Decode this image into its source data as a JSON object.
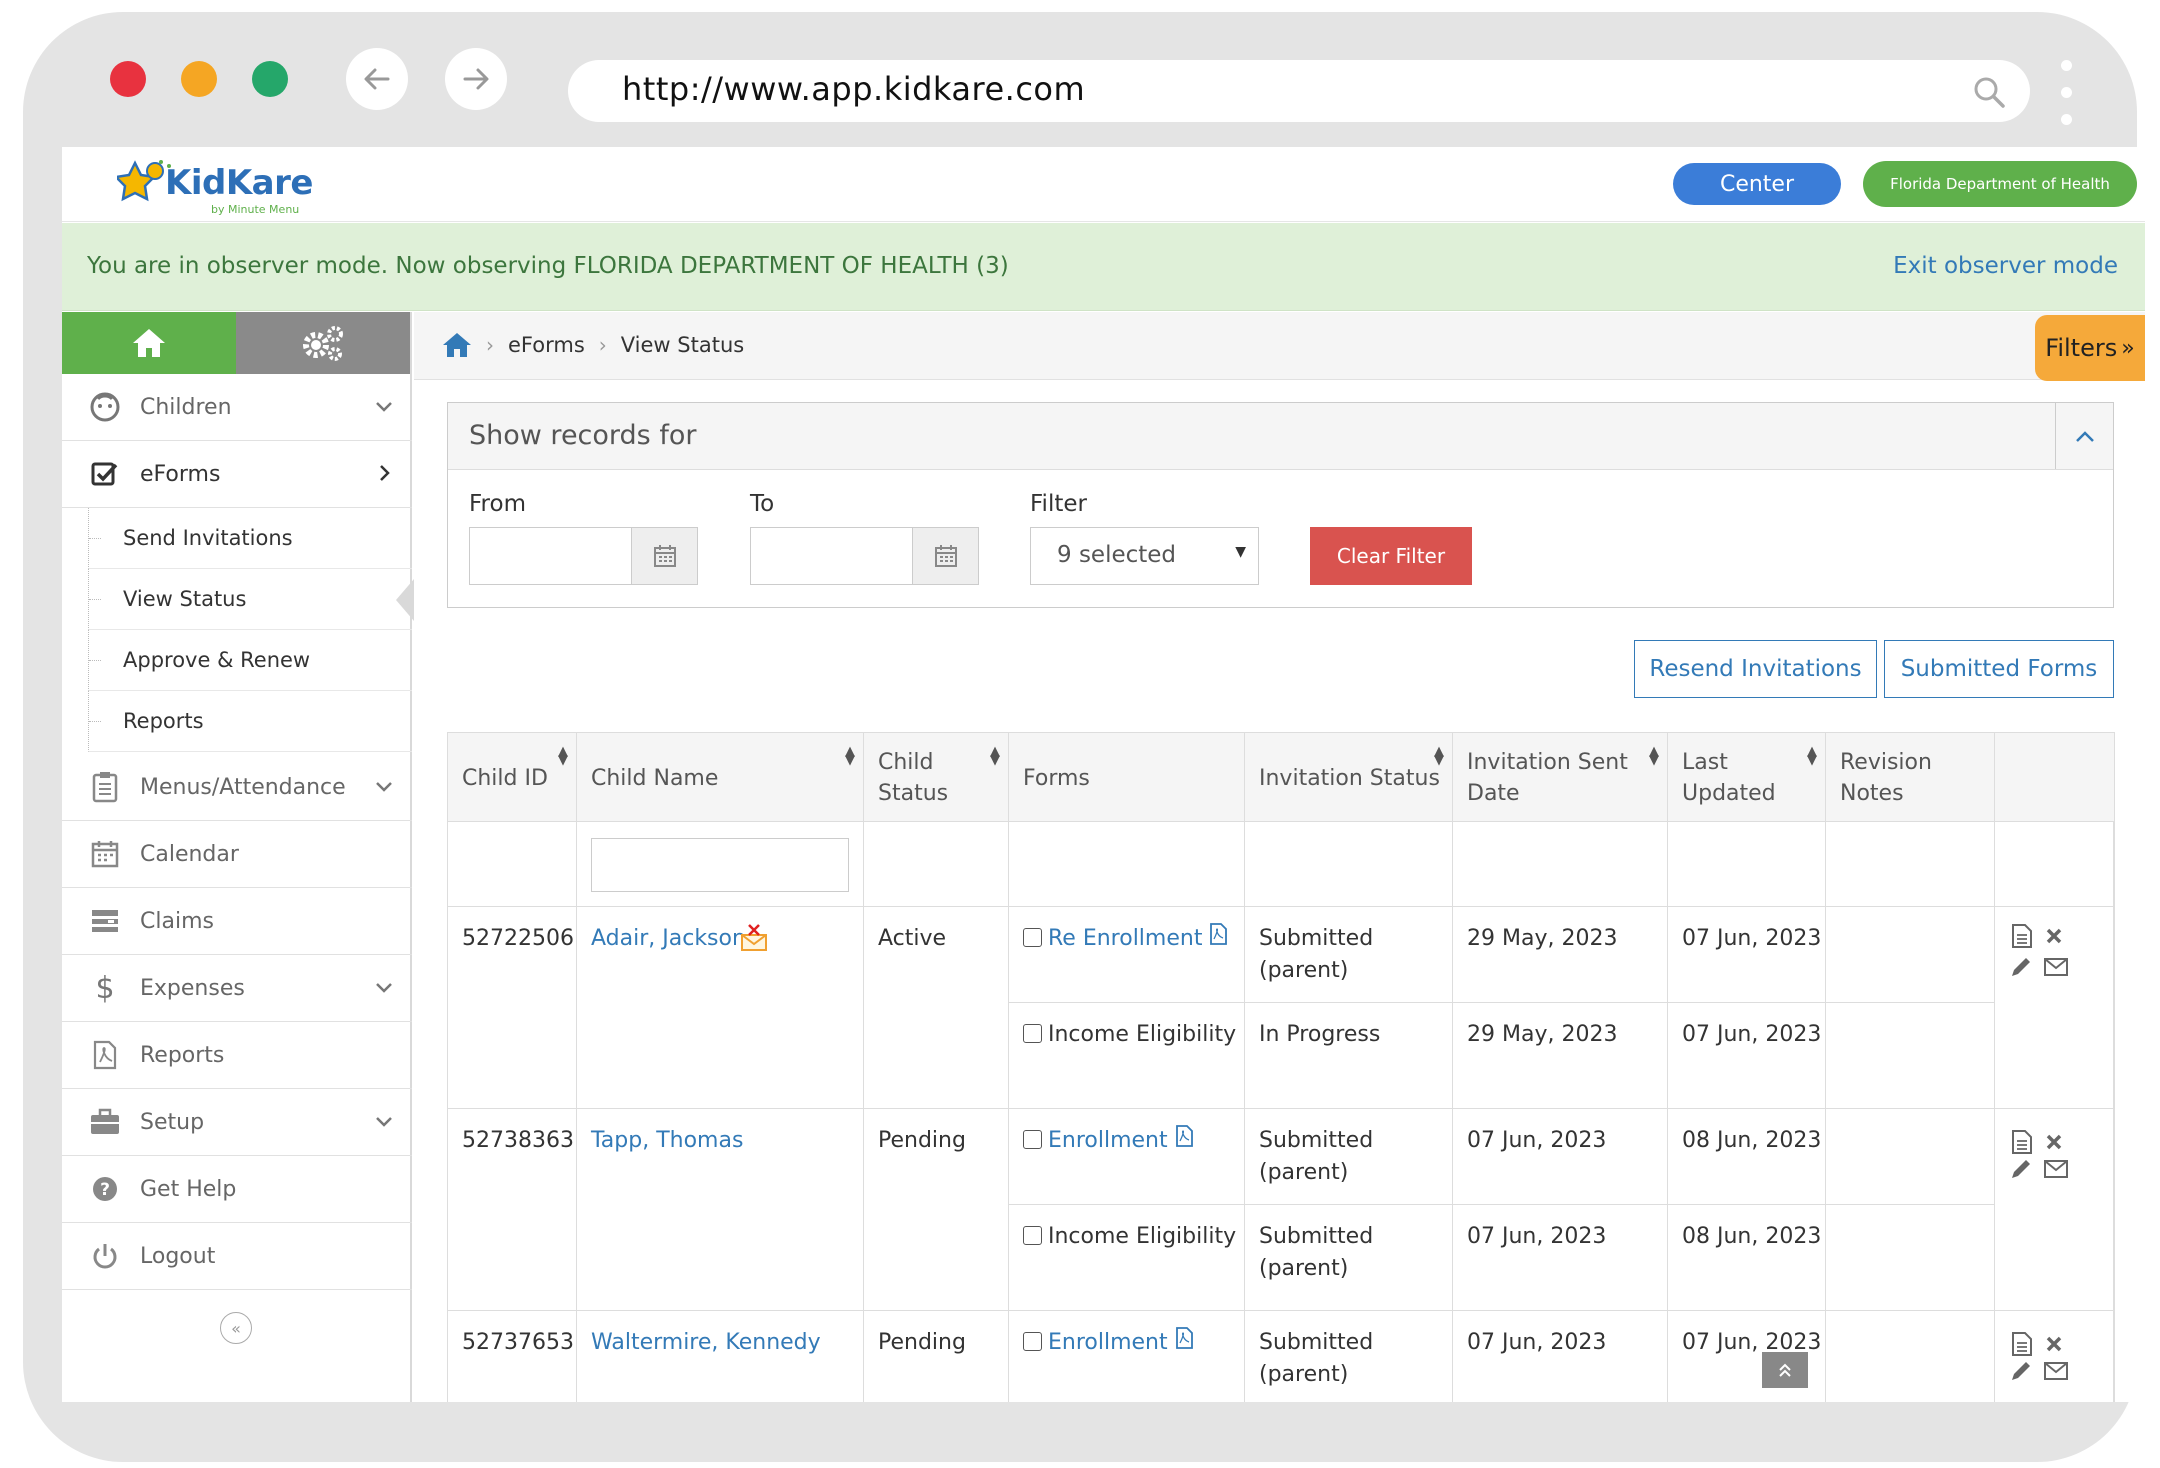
{
  "browser": {
    "url": "http://www.app.kidkare.com",
    "traffic_lights": [
      "#e8323f",
      "#f5a623",
      "#25a76a"
    ]
  },
  "header": {
    "logo_text": "KidKare",
    "logo_sub": "by Minute Menu",
    "center_button": "Center",
    "org_button": "Florida Department of Health"
  },
  "observer": {
    "message": "You are in observer mode. Now observing FLORIDA DEPARTMENT OF HEALTH (3)",
    "exit_link": "Exit observer mode"
  },
  "sidebar": {
    "items": [
      {
        "label": "Children",
        "icon": "child-face-icon",
        "expandable": true
      },
      {
        "label": "eForms",
        "icon": "checkbox-icon",
        "active": true
      },
      {
        "label": "Menus/Attendance",
        "icon": "clipboard-icon",
        "expandable": true
      },
      {
        "label": "Calendar",
        "icon": "calendar-icon"
      },
      {
        "label": "Claims",
        "icon": "claims-icon"
      },
      {
        "label": "Expenses",
        "icon": "dollar-icon",
        "expandable": true
      },
      {
        "label": "Reports",
        "icon": "pdf-file-icon"
      },
      {
        "label": "Setup",
        "icon": "briefcase-icon",
        "expandable": true
      },
      {
        "label": "Get Help",
        "icon": "question-icon"
      },
      {
        "label": "Logout",
        "icon": "power-icon"
      }
    ],
    "eforms_sub": [
      "Send Invitations",
      "View Status",
      "Approve & Renew",
      "Reports"
    ]
  },
  "breadcrumb": {
    "items": [
      "eForms",
      "View Status"
    ]
  },
  "filters_tab": "Filters",
  "panel": {
    "title": "Show records for",
    "from_label": "From",
    "to_label": "To",
    "filter_label": "Filter",
    "filter_value": "9 selected",
    "clear_button": "Clear Filter"
  },
  "buttons": {
    "resend": "Resend Invitations",
    "submitted": "Submitted Forms"
  },
  "table": {
    "headers": {
      "child_id": "Child ID",
      "child_name": "Child Name",
      "child_status_1": "Child",
      "child_status_2": "Status",
      "forms": "Forms",
      "invitation_status": "Invitation Status",
      "sent_1": "Invitation Sent",
      "sent_2": "Date",
      "updated_1": "Last",
      "updated_2": "Updated",
      "notes_1": "Revision",
      "notes_2": "Notes"
    },
    "rows": [
      {
        "id": "52722506",
        "name": "Adair, Jackson",
        "status": "Active",
        "forms": [
          {
            "form": "Re Enrollment",
            "linked": true,
            "inv_1": "Submitted",
            "inv_2": "(parent)",
            "sent": "29 May, 2023",
            "updated": "07 Jun, 2023"
          },
          {
            "form": "Income Eligibility",
            "linked": false,
            "inv_1": "In Progress",
            "inv_2": "",
            "sent": "29 May, 2023",
            "updated": "07 Jun, 2023"
          }
        ]
      },
      {
        "id": "52738363",
        "name": "Tapp, Thomas",
        "status": "Pending",
        "forms": [
          {
            "form": "Enrollment",
            "linked": true,
            "inv_1": "Submitted",
            "inv_2": "(parent)",
            "sent": "07 Jun, 2023",
            "updated": "08 Jun, 2023"
          },
          {
            "form": "Income Eligibility",
            "linked": false,
            "inv_1": "Submitted",
            "inv_2": "(parent)",
            "sent": "07 Jun, 2023",
            "updated": "08 Jun, 2023"
          }
        ]
      },
      {
        "id": "52737653",
        "name": "Waltermire, Kennedy",
        "status": "Pending",
        "forms": [
          {
            "form": "Enrollment",
            "linked": true,
            "inv_1": "Submitted",
            "inv_2": "(parent)",
            "sent": "07 Jun, 2023",
            "updated": "07 Jun, 2023"
          }
        ]
      }
    ]
  }
}
